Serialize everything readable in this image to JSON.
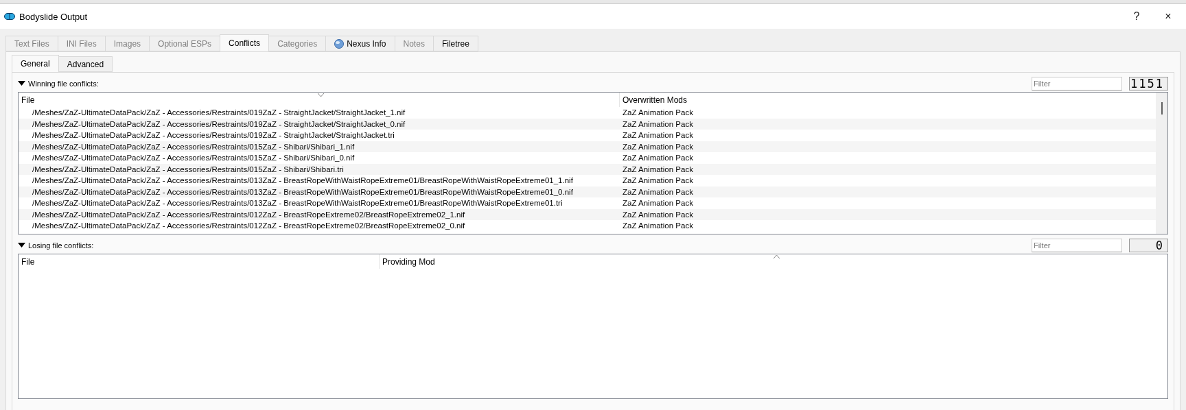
{
  "window": {
    "title": "Bodyslide Output",
    "help": "?",
    "close": "×"
  },
  "tabs": [
    {
      "label": "Text Files",
      "selected": false,
      "disabled": true
    },
    {
      "label": "INI Files",
      "selected": false,
      "disabled": true
    },
    {
      "label": "Images",
      "selected": false,
      "disabled": true
    },
    {
      "label": "Optional ESPs",
      "selected": false,
      "disabled": true
    },
    {
      "label": "Conflicts",
      "selected": true,
      "disabled": false
    },
    {
      "label": "Categories",
      "selected": false,
      "disabled": true
    },
    {
      "label": "Nexus Info",
      "selected": false,
      "disabled": false,
      "kind": "globe"
    },
    {
      "label": "Notes",
      "selected": false,
      "disabled": true
    },
    {
      "label": "Filetree",
      "selected": false,
      "disabled": false
    }
  ],
  "subtabs": [
    {
      "label": "General",
      "selected": true
    },
    {
      "label": "Advanced",
      "selected": false
    }
  ],
  "winning": {
    "title": "Winning file conflicts:",
    "expanded": true,
    "filter": {
      "placeholder": "Filter"
    },
    "count": "1151",
    "columns": [
      "File",
      "Overwritten Mods"
    ],
    "rows": [
      [
        "/Meshes/ZaZ-UltimateDataPack/ZaZ - Accessories/Restraints/019ZaZ - StraightJacket/StraightJacket_1.nif",
        "ZaZ Animation Pack"
      ],
      [
        "/Meshes/ZaZ-UltimateDataPack/ZaZ - Accessories/Restraints/019ZaZ - StraightJacket/StraightJacket_0.nif",
        "ZaZ Animation Pack"
      ],
      [
        "/Meshes/ZaZ-UltimateDataPack/ZaZ - Accessories/Restraints/019ZaZ - StraightJacket/StraightJacket.tri",
        "ZaZ Animation Pack"
      ],
      [
        "/Meshes/ZaZ-UltimateDataPack/ZaZ - Accessories/Restraints/015ZaZ - Shibari/Shibari_1.nif",
        "ZaZ Animation Pack"
      ],
      [
        "/Meshes/ZaZ-UltimateDataPack/ZaZ - Accessories/Restraints/015ZaZ - Shibari/Shibari_0.nif",
        "ZaZ Animation Pack"
      ],
      [
        "/Meshes/ZaZ-UltimateDataPack/ZaZ - Accessories/Restraints/015ZaZ - Shibari/Shibari.tri",
        "ZaZ Animation Pack"
      ],
      [
        "/Meshes/ZaZ-UltimateDataPack/ZaZ - Accessories/Restraints/013ZaZ - BreastRopeWithWaistRopeExtreme01/BreastRopeWithWaistRopeExtreme01_1.nif",
        "ZaZ Animation Pack"
      ],
      [
        "/Meshes/ZaZ-UltimateDataPack/ZaZ - Accessories/Restraints/013ZaZ - BreastRopeWithWaistRopeExtreme01/BreastRopeWithWaistRopeExtreme01_0.nif",
        "ZaZ Animation Pack"
      ],
      [
        "/Meshes/ZaZ-UltimateDataPack/ZaZ - Accessories/Restraints/013ZaZ - BreastRopeWithWaistRopeExtreme01/BreastRopeWithWaistRopeExtreme01.tri",
        "ZaZ Animation Pack"
      ],
      [
        "/Meshes/ZaZ-UltimateDataPack/ZaZ - Accessories/Restraints/012ZaZ - BreastRopeExtreme02/BreastRopeExtreme02_1.nif",
        "ZaZ Animation Pack"
      ],
      [
        "/Meshes/ZaZ-UltimateDataPack/ZaZ - Accessories/Restraints/012ZaZ - BreastRopeExtreme02/BreastRopeExtreme02_0.nif",
        "ZaZ Animation Pack"
      ]
    ]
  },
  "losing": {
    "title": "Losing file conflicts:",
    "expanded": true,
    "filter": {
      "placeholder": "Filter"
    },
    "count": "0",
    "columns": [
      "File",
      "Providing Mod"
    ]
  }
}
